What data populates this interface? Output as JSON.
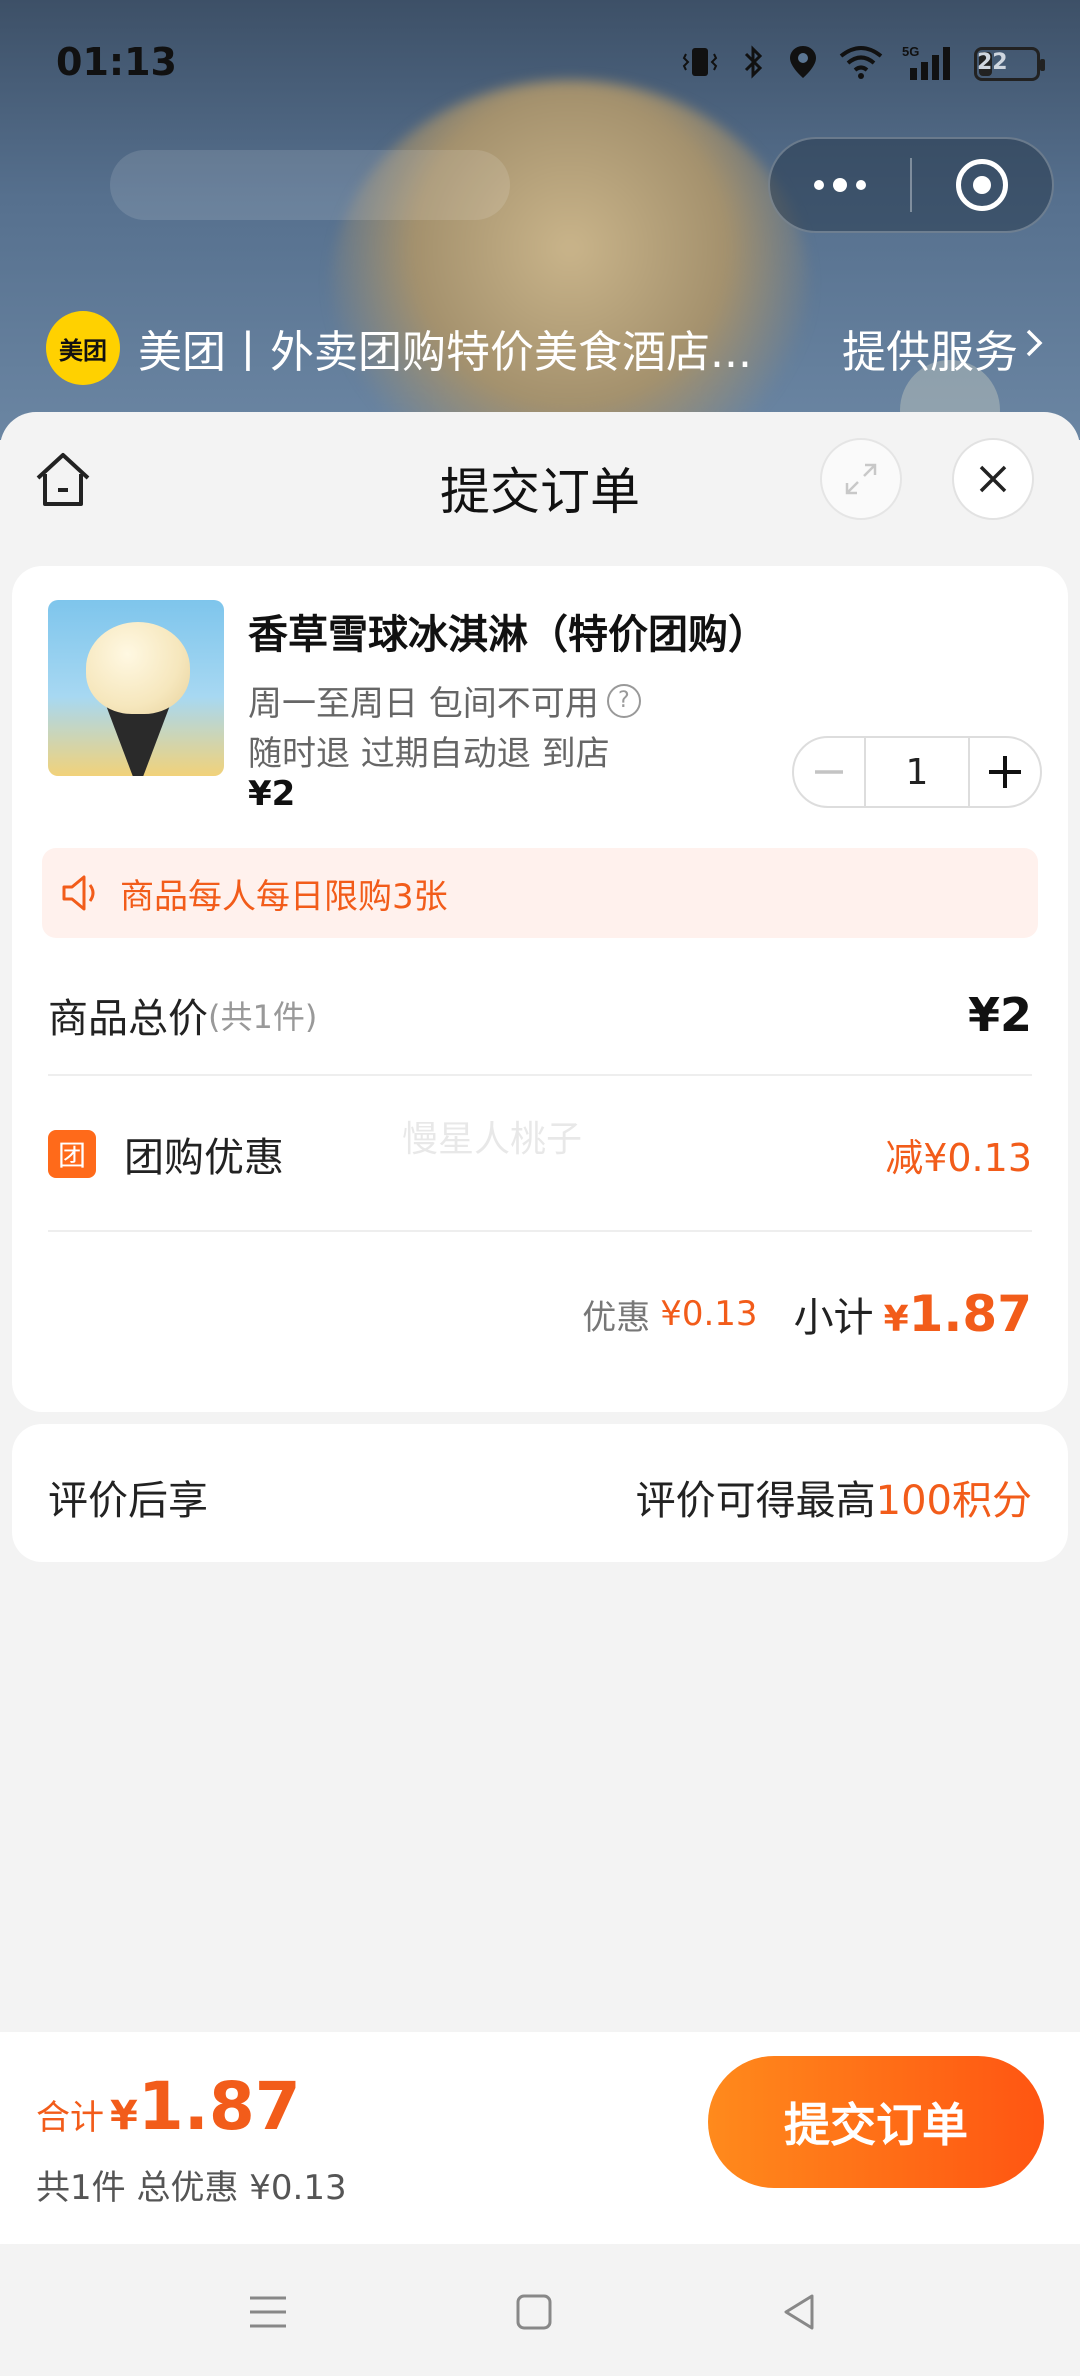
{
  "status_bar": {
    "time": "01:13",
    "battery": "22",
    "network": "5G"
  },
  "mini_program": {
    "logo_text": "美团",
    "title": "美团丨外卖团购特价美食酒店...",
    "service_label": "提供服务"
  },
  "header": {
    "title": "提交订单"
  },
  "product": {
    "name": "香草雪球冰淇淋（特价团购）",
    "usage": "周一至周日 包间不可用",
    "refund": "随时退 过期自动退 到店",
    "price": "¥2",
    "quantity": "1",
    "decrease_symbol": "−",
    "increase_symbol": "+"
  },
  "notice": {
    "text": "商品每人每日限购3张"
  },
  "summary": {
    "total_label": "商品总价",
    "total_count": "(共1件)",
    "total_amount": "¥2",
    "discount_badge": "团",
    "discount_label": "团购优惠",
    "discount_amount": "减¥0.13",
    "savings_label": "优惠",
    "savings_amount": "¥0.13",
    "subtotal_label": "小计",
    "subtotal_symbol": "¥",
    "subtotal_amount": "1.87",
    "watermark": "慢星人桃子"
  },
  "review": {
    "label": "评价后享",
    "desc_prefix": "评价可得最高",
    "desc_highlight": "100积分"
  },
  "footer": {
    "total_label": "合计",
    "total_symbol": "¥",
    "total_amount": "1.87",
    "sub_text": "共1件 总优惠 ¥0.13",
    "submit_label": "提交订单"
  },
  "colors": {
    "accent": "#f25c1a",
    "button_start": "#ff8a1c",
    "button_end": "#ff5512",
    "brand_yellow": "#ffd100"
  }
}
